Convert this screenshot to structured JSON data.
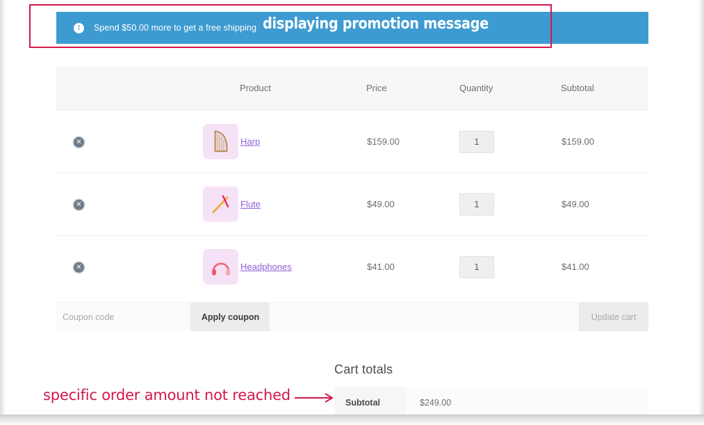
{
  "promo_banner": {
    "icon": "info-circle-icon",
    "message": "Spend $50.00 more to get a free shipping",
    "background_color": "#3d9bd1"
  },
  "annotations": {
    "promotion": {
      "text": "displaying promotion message",
      "box_color": "#d3174a",
      "text_color": "#ffffff"
    },
    "order_amount": {
      "text": "specific order amount not reached",
      "color": "#d3174a",
      "arrow": "right-arrow-icon"
    }
  },
  "cart_table": {
    "columns": [
      "",
      "",
      "Product",
      "Price",
      "Quantity",
      "Subtotal"
    ],
    "rows": [
      {
        "remove_icon": "remove-circle-icon",
        "thumbnail": "harp-thumbnail",
        "product": "Harp",
        "price": "$159.00",
        "quantity": "1",
        "subtotal": "$159.00"
      },
      {
        "remove_icon": "remove-circle-icon",
        "thumbnail": "flute-thumbnail",
        "product": "Flute",
        "price": "$49.00",
        "quantity": "1",
        "subtotal": "$49.00"
      },
      {
        "remove_icon": "remove-circle-icon",
        "thumbnail": "headphones-thumbnail",
        "product": "Headphones",
        "price": "$41.00",
        "quantity": "1",
        "subtotal": "$41.00"
      }
    ]
  },
  "cart_actions": {
    "coupon_placeholder": "Coupon code",
    "coupon_value": "",
    "apply_coupon_label": "Apply coupon",
    "update_cart_label": "Update cart"
  },
  "cart_totals": {
    "title": "Cart totals",
    "rows": [
      {
        "label": "Subtotal",
        "value": "$249.00"
      }
    ]
  }
}
